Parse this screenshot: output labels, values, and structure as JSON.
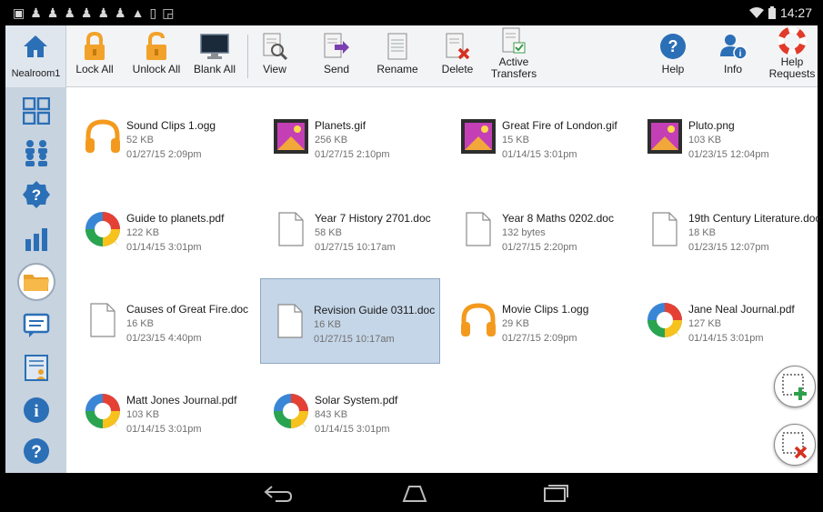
{
  "status_bar": {
    "time": "14:27"
  },
  "home": {
    "label": "Nealroom1"
  },
  "toolbar": {
    "lock_all": "Lock All",
    "unlock_all": "Unlock All",
    "blank_all": "Blank All",
    "view": "View",
    "send": "Send",
    "rename": "Rename",
    "delete": "Delete",
    "active_transfers_line1": "Active",
    "active_transfers_line2": "Transfers",
    "help": "Help",
    "info": "Info",
    "help_requests_line1": "Help",
    "help_requests_line2": "Requests"
  },
  "files": [
    {
      "name": "Sound Clips 1.ogg",
      "size": "52 KB",
      "date": "01/27/15 2:09pm",
      "icon": "headphones-icon"
    },
    {
      "name": "Planets.gif",
      "size": "256 KB",
      "date": "01/27/15 2:10pm",
      "icon": "image-icon"
    },
    {
      "name": "Great Fire of London.gif",
      "size": "15 KB",
      "date": "01/14/15 3:01pm",
      "icon": "image-icon"
    },
    {
      "name": "Pluto.png",
      "size": "103 KB",
      "date": "01/23/15 12:04pm",
      "icon": "image-icon"
    },
    {
      "name": "Guide to planets.pdf",
      "size": "122 KB",
      "date": "01/14/15 3:01pm",
      "icon": "pdf-icon"
    },
    {
      "name": "Year 7 History 2701.doc",
      "size": "58 KB",
      "date": "01/27/15 10:17am",
      "icon": "document-icon"
    },
    {
      "name": "Year 8 Maths 0202.doc",
      "size": "132 bytes",
      "date": "01/27/15 2:20pm",
      "icon": "document-icon"
    },
    {
      "name": "19th Century Literature.doc",
      "size": "18 KB",
      "date": "01/23/15 12:07pm",
      "icon": "document-icon"
    },
    {
      "name": "Causes of Great Fire.doc",
      "size": "16 KB",
      "date": "01/23/15 4:40pm",
      "icon": "document-icon"
    },
    {
      "name": "Revision Guide 0311.doc",
      "size": "16 KB",
      "date": "01/27/15 10:17am",
      "icon": "document-icon"
    },
    {
      "name": "Movie Clips 1.ogg",
      "size": "29 KB",
      "date": "01/27/15 2:09pm",
      "icon": "headphones-icon"
    },
    {
      "name": "Jane Neal Journal.pdf",
      "size": "127 KB",
      "date": "01/14/15 3:01pm",
      "icon": "pdf-icon"
    },
    {
      "name": "Matt Jones Journal.pdf",
      "size": "103 KB",
      "date": "01/14/15 3:01pm",
      "icon": "pdf-icon"
    },
    {
      "name": "Solar System.pdf",
      "size": "843 KB",
      "date": "01/14/15 3:01pm",
      "icon": "pdf-icon"
    }
  ],
  "colors": {
    "sidebar": "#c7d3df",
    "accent_blue": "#2b6fb6",
    "orange": "#f39a1e",
    "selection": "#c5d6e8"
  }
}
